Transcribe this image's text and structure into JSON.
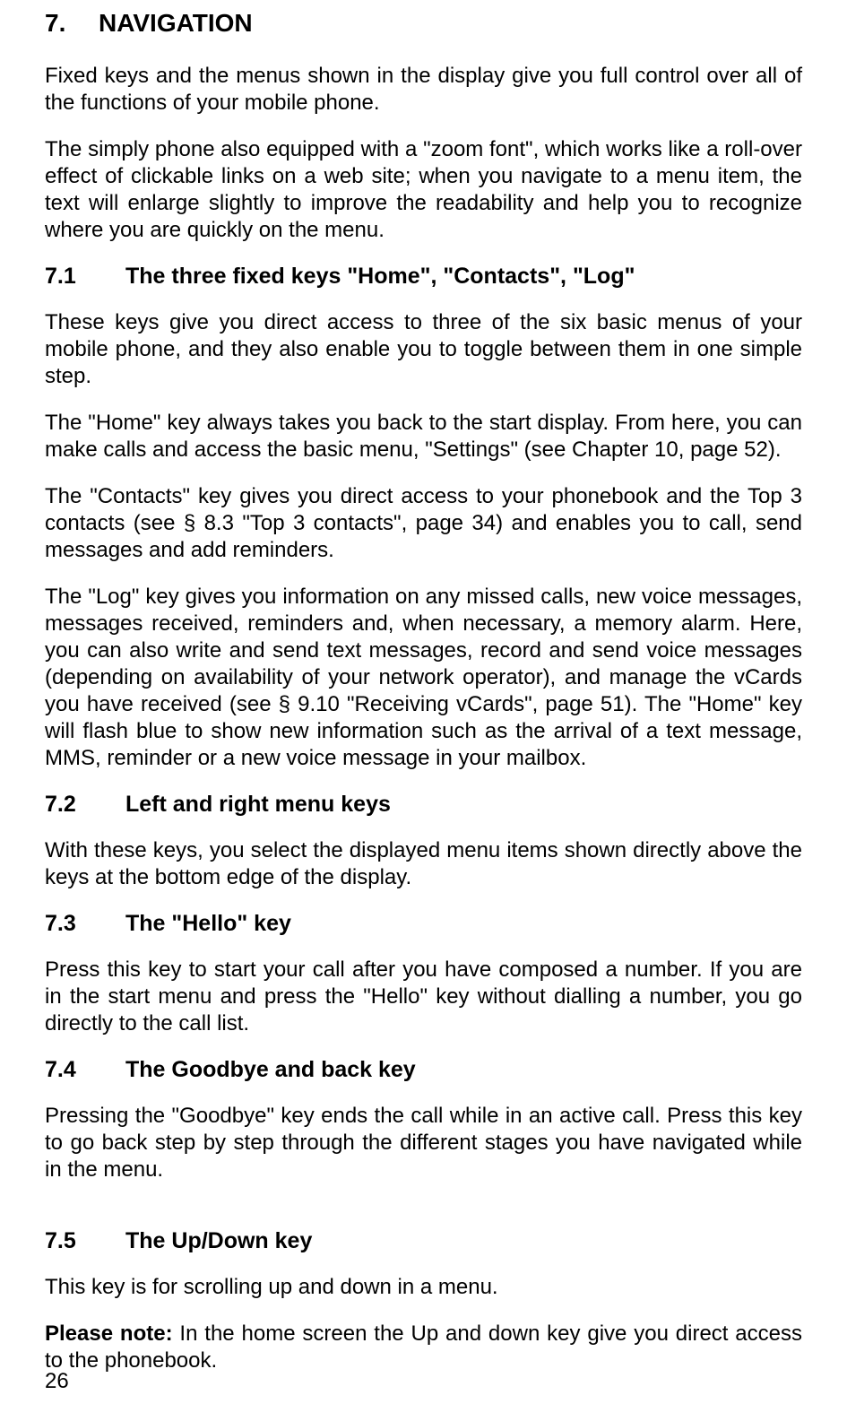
{
  "s7": {
    "num": "7.",
    "title_first": "N",
    "title_rest": "AVIGATION",
    "p1": "Fixed keys and the menus shown in the display give you full control over all of the functions of your mobile phone.",
    "p2": "The simply phone also equipped with a \"zoom font\", which works like a roll-over effect of clickable links on a web site; when you navigate to a menu item, the text will enlarge slightly to improve the readability and help you to recognize where you are quickly on the menu."
  },
  "s71": {
    "num": "7.1",
    "title": "The three fixed keys \"Home\", \"Contacts\", \"Log\"",
    "p1": "These keys give you direct access to three of the six basic menus of your mobile phone, and they also enable you to toggle between them in one simple step.",
    "p2": "The \"Home\" key always takes you back to the start display. From here, you can make calls and access the basic menu, \"Settings\" (see Chapter 10, page 52).",
    "p3": "The \"Contacts\" key gives you direct access to your phonebook and the Top 3 contacts (see § 8.3 \"Top 3 contacts\", page 34) and enables you to call, send messages and add reminders.",
    "p4": "The \"Log\" key gives you information on any missed calls, new voice messages, messages received, reminders and, when necessary, a memory alarm. Here, you can also write and send text messages, record and send voice messages (depending on availability of your network operator), and manage the vCards you have received (see § 9.10 \"Receiving vCards\", page 51). The \"Home\" key will flash blue to show new information such as the arrival of a text message, MMS, reminder or a new voice message in your mailbox."
  },
  "s72": {
    "num": "7.2",
    "title": "Left and right menu keys",
    "p1": "With these keys, you select the displayed menu items shown directly above the keys at the bottom edge of the display."
  },
  "s73": {
    "num": "7.3",
    "title": "The \"Hello\" key",
    "p1": "Press this key to start your call after you have composed a number. If you are in the start menu and press the \"Hello\" key without dialling a number, you go directly to the call list."
  },
  "s74": {
    "num": "7.4",
    "title": "The Goodbye and back key",
    "p1": "Pressing the \"Goodbye\" key ends the call while in an active call. Press this key to go back step by step through the different stages you have navigated while in the menu."
  },
  "s75": {
    "num": "7.5",
    "title": "The Up/Down key",
    "p1": "This key is for scrolling up and down in a menu.",
    "note_label": "Please note:",
    "note_text": " In the home screen the Up and down key give you direct access to the phonebook."
  },
  "page_number": "26"
}
